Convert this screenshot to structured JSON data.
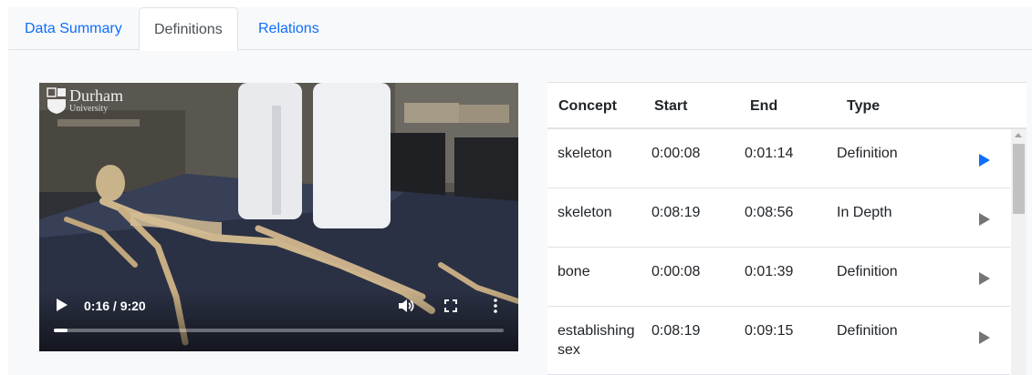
{
  "tabs": [
    {
      "label": "Data Summary",
      "active": false
    },
    {
      "label": "Definitions",
      "active": true
    },
    {
      "label": "Relations",
      "active": false
    }
  ],
  "video": {
    "logo_line1": "Durham",
    "logo_line2": "University",
    "time_display": "0:16 / 9:20",
    "progress": 0.03,
    "icons": [
      "play-icon",
      "volume-icon",
      "fullscreen-icon",
      "more-options-icon"
    ]
  },
  "table": {
    "headers": {
      "concept": "Concept",
      "start": "Start",
      "end": "End",
      "type": "Type"
    },
    "rows": [
      {
        "concept": "skeleton",
        "start": "0:00:08",
        "end": "0:01:14",
        "type": "Definition",
        "playing": true
      },
      {
        "concept": "skeleton",
        "start": "0:08:19",
        "end": "0:08:56",
        "type": "In Depth",
        "playing": false
      },
      {
        "concept": "bone",
        "start": "0:00:08",
        "end": "0:01:39",
        "type": "Definition",
        "playing": false
      },
      {
        "concept": "establishing sex",
        "start": "0:08:19",
        "end": "0:09:15",
        "type": "Definition",
        "playing": false
      }
    ]
  },
  "colors": {
    "link": "#0d6efd",
    "active_play": "#0d6efd",
    "inactive_play": "#757575"
  }
}
